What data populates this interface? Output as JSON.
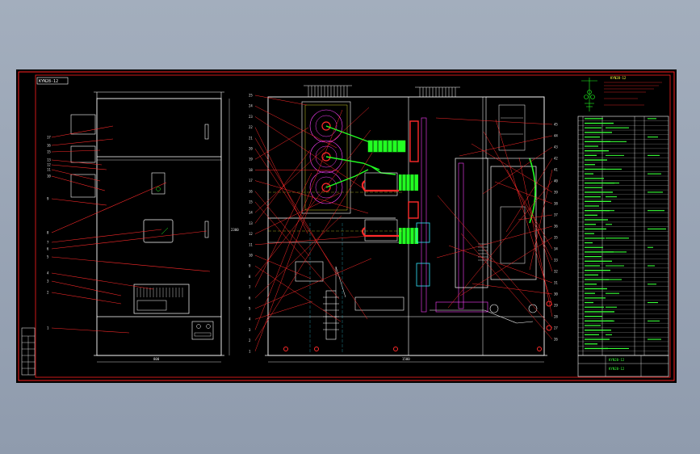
{
  "sheet": {
    "title_stamp": "KYN28-12",
    "frame_color": "#ff2020",
    "background": "#000000",
    "colors": {
      "outline": "#ffffff",
      "leader": "#ff2a2a",
      "busbar": "#22ff22",
      "insulator": "#ff2a2a",
      "grounding": "#ff2a2a",
      "cyan": "#33e5ff",
      "magenta": "#ff40ff",
      "yellow": "#ffff30"
    }
  },
  "front_view": {
    "callouts": [
      "17",
      "16",
      "15",
      "13",
      "12",
      "11",
      "10",
      "9",
      "8",
      "7",
      "6",
      "5",
      "4",
      "3",
      "2",
      "1"
    ],
    "width_dim": "800",
    "height_dim": "2300"
  },
  "side_view": {
    "callouts_left": [
      "25",
      "24",
      "23",
      "22",
      "21",
      "20",
      "19",
      "18",
      "17",
      "16",
      "15",
      "14",
      "13",
      "12",
      "11",
      "10",
      "9",
      "8",
      "7",
      "6",
      "5",
      "4",
      "3",
      "2",
      "1"
    ],
    "callouts_right": [
      "45",
      "44",
      "43",
      "42",
      "41",
      "40",
      "39",
      "38",
      "37",
      "36",
      "35",
      "34",
      "33",
      "32",
      "31",
      "30",
      "29",
      "28",
      "27",
      "26"
    ],
    "width_dim": "1500"
  },
  "bom": {
    "rows": 52,
    "title_block_label": "KYN28-12",
    "drawing_name": "KYN28-12",
    "schematic_title": "KYN28-12"
  }
}
